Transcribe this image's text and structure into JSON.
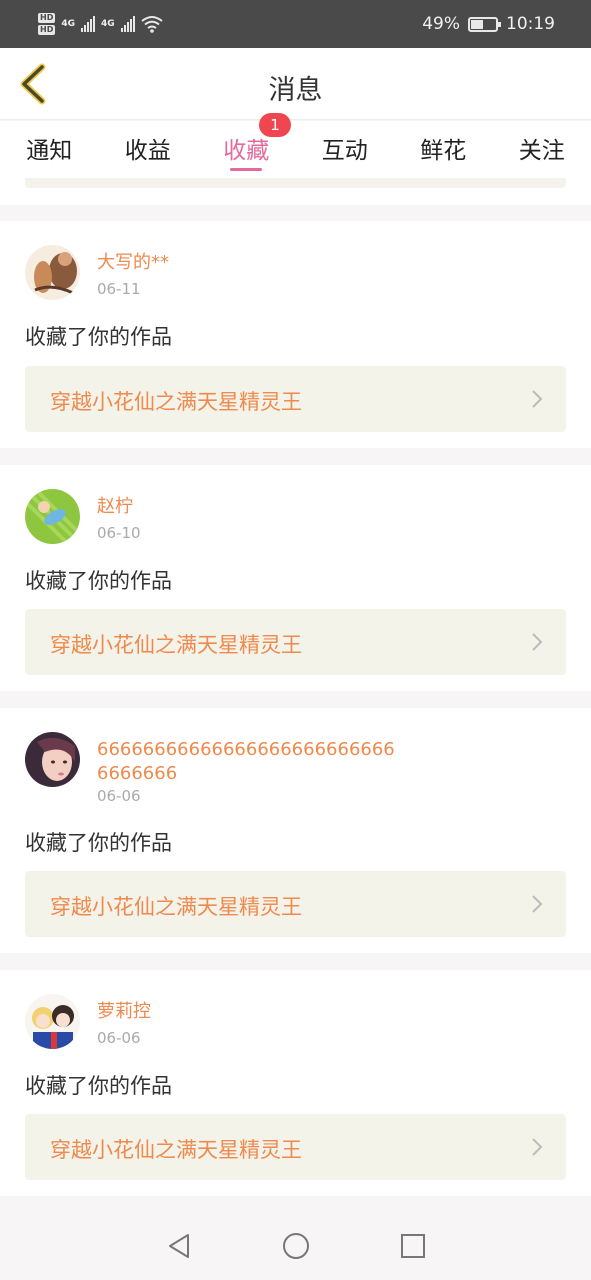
{
  "status_bar": {
    "left_indicators": [
      "HD",
      "HD"
    ],
    "network_1": "4G",
    "network_2": "4G",
    "battery_percent": "49%",
    "battery_level": 0.49,
    "time": "10:19"
  },
  "header": {
    "title": "消息",
    "back_icon": "chevron-left-icon"
  },
  "tabs": [
    {
      "label": "通知",
      "active": false
    },
    {
      "label": "收益",
      "active": false
    },
    {
      "label": "收藏",
      "active": true,
      "badge": "1"
    },
    {
      "label": "互动",
      "active": false
    },
    {
      "label": "鲜花",
      "active": false
    },
    {
      "label": "关注",
      "active": false
    }
  ],
  "colors": {
    "accent_pink": "#e56a9c",
    "username_orange": "#ee8a4d",
    "badge_red": "#f04650",
    "work_box_bg": "#f4f3ea"
  },
  "messages": [
    {
      "username": "大写的**",
      "date": "06-11",
      "action": "收藏了你的作品",
      "work_title": "穿越小花仙之满天星精灵王"
    },
    {
      "username": "赵柠",
      "date": "06-10",
      "action": "收藏了你的作品",
      "work_title": "穿越小花仙之满天星精灵王"
    },
    {
      "username": "666666666666666666666666666666666",
      "date": "06-06",
      "action": "收藏了你的作品",
      "work_title": "穿越小花仙之满天星精灵王"
    },
    {
      "username": "萝莉控",
      "date": "06-06",
      "action": "收藏了你的作品",
      "work_title": "穿越小花仙之满天星精灵王"
    }
  ],
  "nav": {
    "back": "triangle-back-icon",
    "home": "circle-home-icon",
    "recent": "square-recents-icon"
  }
}
